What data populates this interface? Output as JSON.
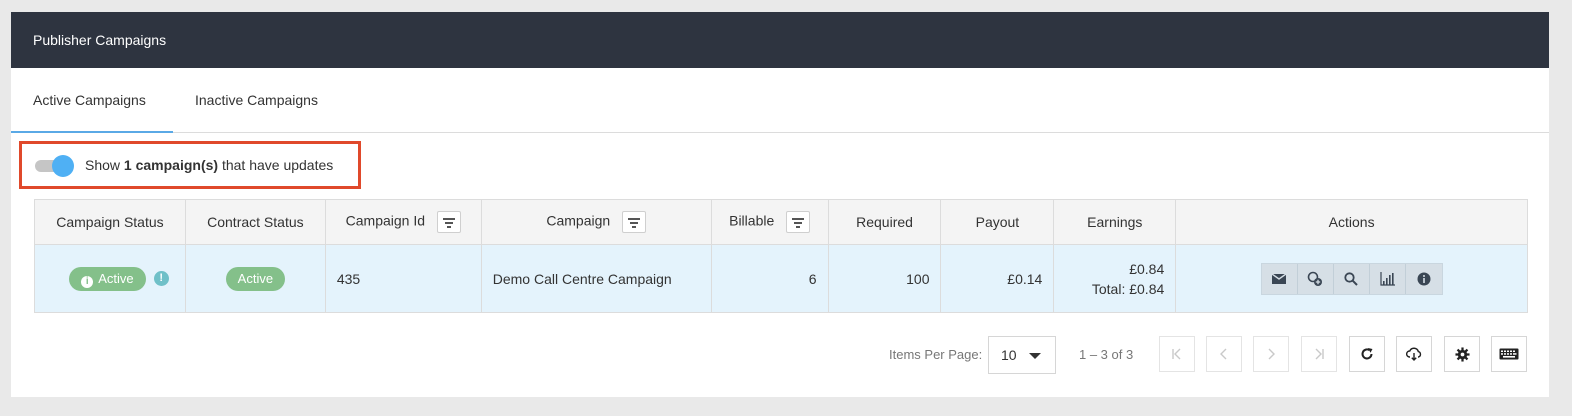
{
  "header": {
    "title": "Publisher Campaigns"
  },
  "tabs": [
    {
      "label": "Active Campaigns",
      "active": true
    },
    {
      "label": "Inactive Campaigns",
      "active": false
    }
  ],
  "toggle": {
    "prefix": "Show",
    "count_text": "1 campaign(s)",
    "suffix": "that have updates",
    "on": true
  },
  "table": {
    "columns": [
      "Campaign Status",
      "Contract Status",
      "Campaign Id",
      "Campaign",
      "Billable",
      "Required",
      "Payout",
      "Earnings",
      "Actions"
    ],
    "rows": [
      {
        "campaign_status": "Active",
        "contract_status": "Active",
        "campaign_id": "435",
        "campaign": "Demo Call Centre Campaign",
        "billable": "6",
        "required": "100",
        "payout": "£0.14",
        "earnings": "£0.84",
        "earnings_total": "Total: £0.84"
      }
    ],
    "action_icons": [
      "envelope-icon",
      "connect-add-icon",
      "search-icon",
      "bar-chart-icon",
      "info-icon"
    ]
  },
  "pager": {
    "items_per_page_label": "Items Per Page:",
    "items_per_page_value": "10",
    "range_text": "1 – 3 of 3"
  },
  "colors": {
    "header_bg": "#2e3440",
    "tab_underline": "#5aa9e6",
    "highlight_border": "#e0492b",
    "toggle_knob": "#4fb0f4",
    "badge_active": "#84c08a",
    "row_bg": "#e4f3fc"
  }
}
